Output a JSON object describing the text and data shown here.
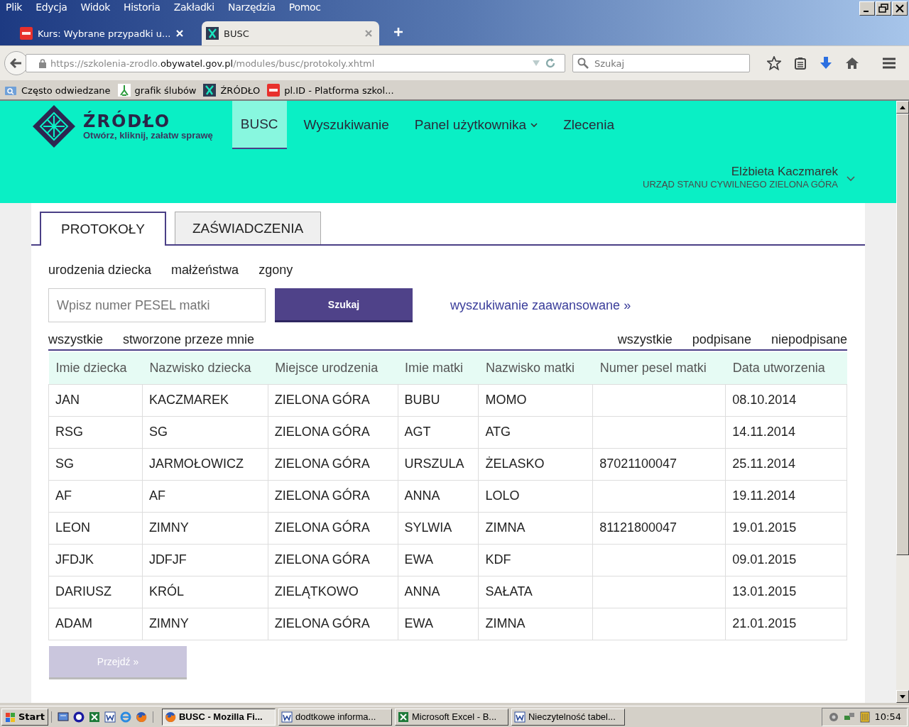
{
  "menu_bar": [
    "Plik",
    "Edycja",
    "Widok",
    "Historia",
    "Zakładki",
    "Narzędzia",
    "Pomoc"
  ],
  "browser_tabs": [
    {
      "title": "Kurs: Wybrane przypadki u...",
      "selected": false
    },
    {
      "title": "BUSC",
      "selected": true
    }
  ],
  "address_bar": {
    "prefix": "https://szkolenia-zrodlo.",
    "domain": "obywatel.gov.pl",
    "path": "/modules/busc/protokoly.xhtml"
  },
  "search_bar": {
    "placeholder": "Szukaj"
  },
  "bookmarks": [
    "Często odwiedzane",
    "grafik ślubów",
    "ŹRÓDŁO",
    "pl.ID - Platforma szkol..."
  ],
  "site": {
    "logo_title": "ŹRÓDŁO",
    "logo_tagline": "Otwórz, kliknij, załatw sprawę",
    "nav": [
      {
        "label": "BUSC",
        "selected": true,
        "dropdown": false
      },
      {
        "label": "Wyszukiwanie",
        "selected": false,
        "dropdown": false
      },
      {
        "label": "Panel użytkownika",
        "selected": false,
        "dropdown": true
      },
      {
        "label": "Zlecenia",
        "selected": false,
        "dropdown": false
      }
    ],
    "user_name": "Elżbieta Kaczmarek",
    "user_office": "URZĄD STANU CYWILNEGO ZIELONA GÓRA"
  },
  "page_tabs": [
    {
      "label": "PROTOKOŁY",
      "selected": true
    },
    {
      "label": "ZAŚWIADCZENIA",
      "selected": false
    }
  ],
  "categories": [
    "urodzenia dziecka",
    "małżeństwa",
    "zgony"
  ],
  "search": {
    "placeholder": "Wpisz numer PESEL matki",
    "button": "Szukaj",
    "advanced_link": "wyszukiwanie zaawansowane »"
  },
  "filters_left": [
    "wszystkie",
    "stworzone przeze mnie"
  ],
  "filters_right": [
    "wszystkie",
    "podpisane",
    "niepodpisane"
  ],
  "table": {
    "columns": [
      "Imie dziecka",
      "Nazwisko dziecka",
      "Miejsce urodzenia",
      "Imie matki",
      "Nazwisko matki",
      "Numer pesel matki",
      "Data utworzenia"
    ],
    "rows": [
      [
        "JAN",
        "KACZMAREK",
        "ZIELONA GÓRA",
        "BUBU",
        "MOMO",
        "",
        "08.10.2014"
      ],
      [
        "RSG",
        "SG",
        "ZIELONA GÓRA",
        "AGT",
        "ATG",
        "",
        "14.11.2014"
      ],
      [
        "SG",
        "JARMOŁOWICZ",
        "ZIELONA GÓRA",
        "URSZULA",
        "ŻELASKO",
        "87021100047",
        "25.11.2014"
      ],
      [
        "AF",
        "AF",
        "ZIELONA GÓRA",
        "ANNA",
        "LOLO",
        "",
        "19.11.2014"
      ],
      [
        "LEON",
        "ZIMNY",
        "ZIELONA GÓRA",
        "SYLWIA",
        "ZIMNA",
        "81121800047",
        "19.01.2015"
      ],
      [
        "JFDJK",
        "JDFJF",
        "ZIELONA GÓRA",
        "EWA",
        "KDF",
        "",
        "09.01.2015"
      ],
      [
        "DARIUSZ",
        "KRÓL",
        "ZIELĄTKOWO",
        "ANNA",
        "SAŁATA",
        "",
        "13.01.2015"
      ],
      [
        "ADAM",
        "ZIMNY",
        "ZIELONA GÓRA",
        "EWA",
        "ZIMNA",
        "",
        "21.01.2015"
      ]
    ]
  },
  "go_button": {
    "label": "Przejdź »",
    "disabled": true
  },
  "taskbar": {
    "start": "Start",
    "windows": [
      {
        "label": "BUSC - Mozilla Fi...",
        "selected": true
      },
      {
        "label": "dodtkowe informa...",
        "selected": false
      },
      {
        "label": "Microsoft Excel - B...",
        "selected": false
      },
      {
        "label": "Nieczytelność tabel...",
        "selected": false
      }
    ],
    "clock": "10:54"
  }
}
